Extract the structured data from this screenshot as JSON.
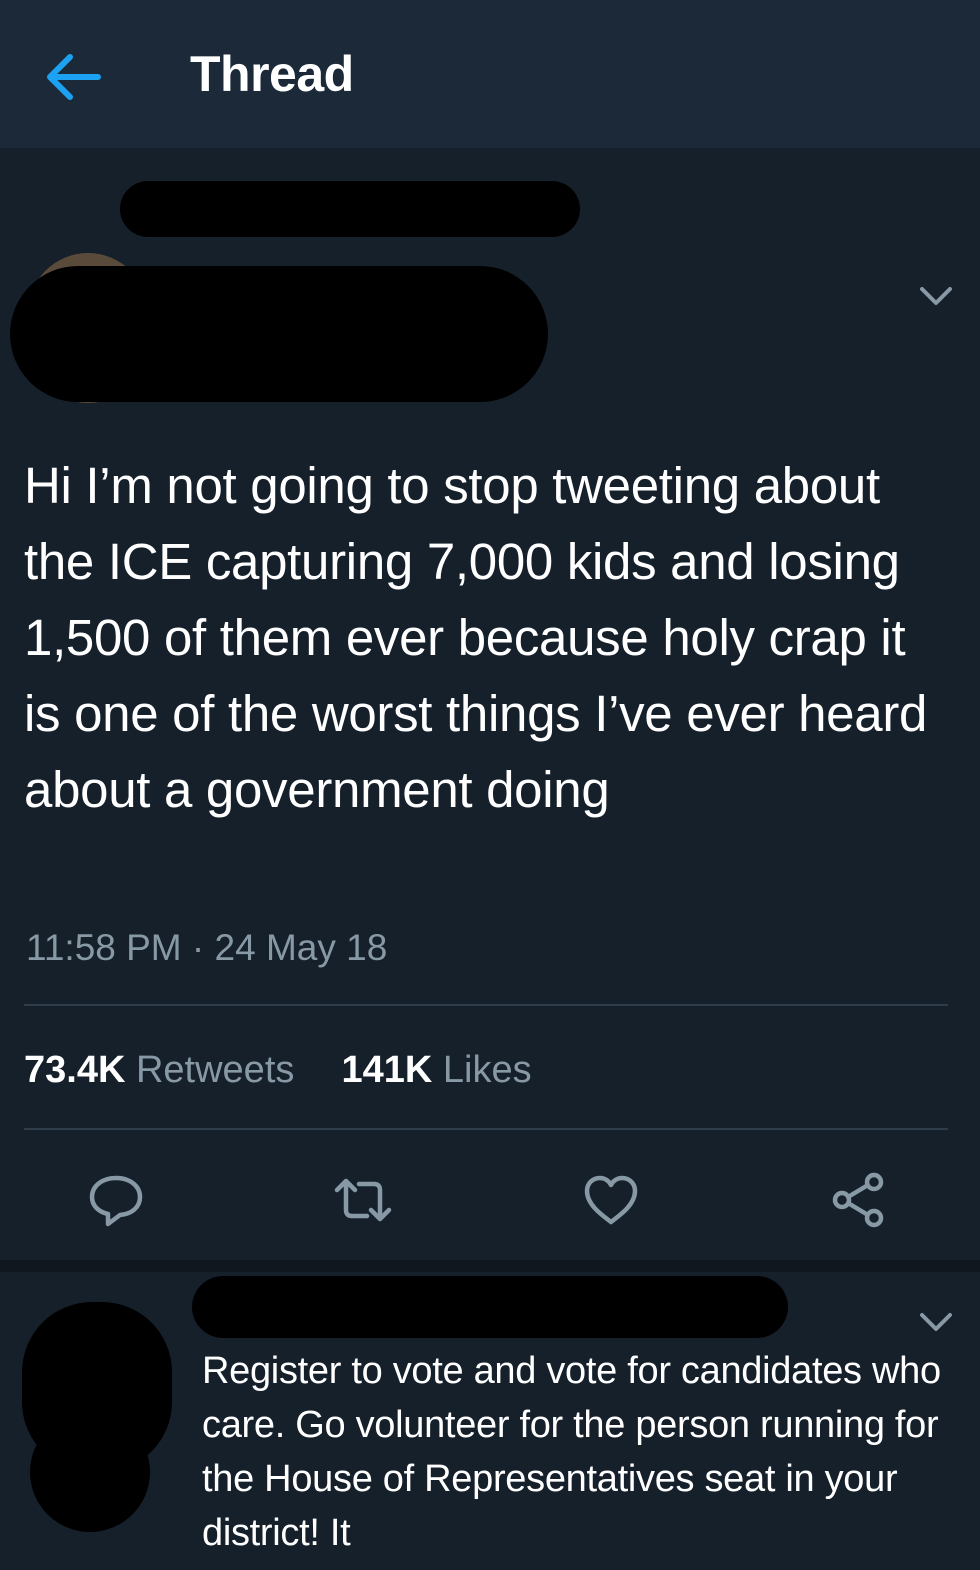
{
  "header": {
    "back_icon": "arrow-left-icon",
    "title": "Thread",
    "accent": "#1da1f2"
  },
  "main_tweet": {
    "text": "Hi I’m not going to stop tweeting about the ICE capturing 7,000 kids and losing 1,500 of them ever because holy crap it is one of the worst things I’ve ever heard about a government doing",
    "time": "11:58 PM",
    "separator": "·",
    "date": "24 May 18",
    "retweets_count": "73.4K",
    "retweets_label": "Retweets",
    "likes_count": "141K",
    "likes_label": "Likes",
    "actions": [
      "reply-icon",
      "retweet-icon",
      "like-icon",
      "share-icon"
    ]
  },
  "reply_tweet": {
    "text": "Register to vote and vote for candidates who care. Go volunteer for the person running for the House of Representatives seat in your district! It"
  },
  "colors": {
    "background": "#15202b",
    "header": "#1c2938",
    "muted": "#8899a6",
    "divider": "#2f3d4b"
  }
}
